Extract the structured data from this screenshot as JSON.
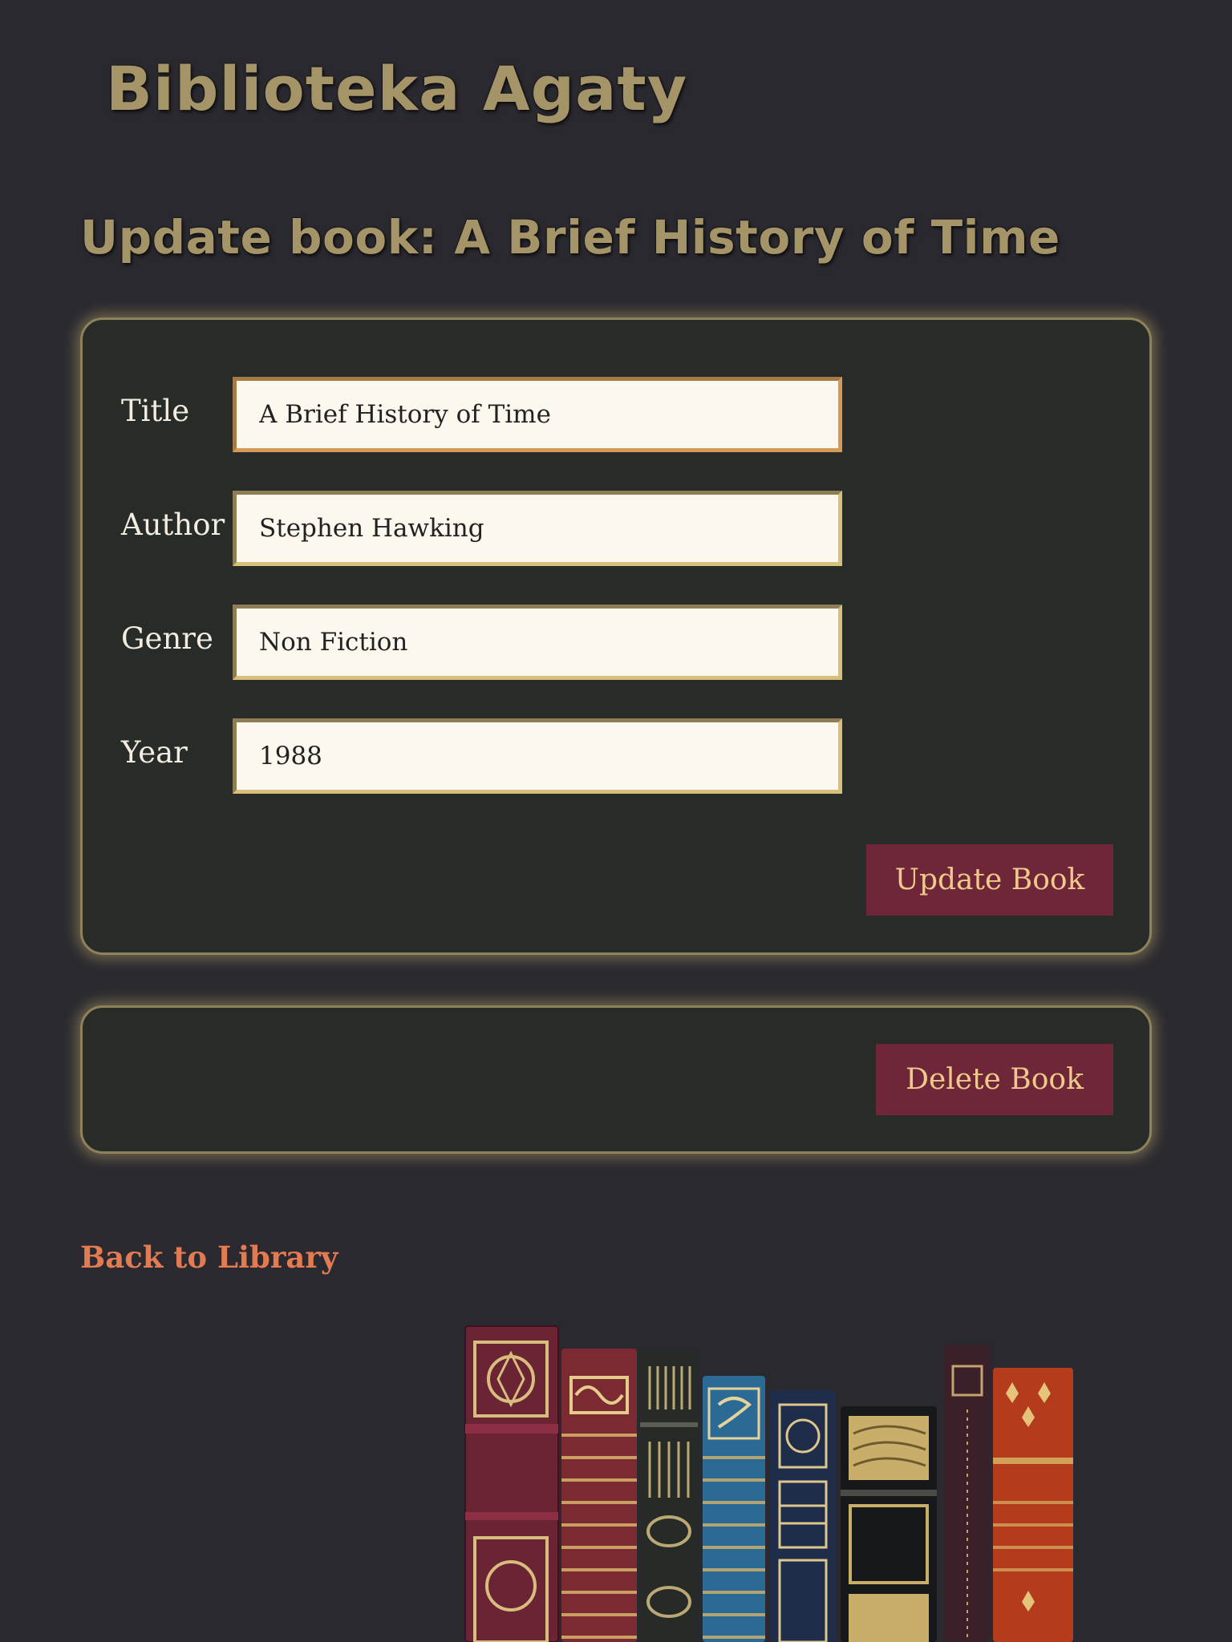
{
  "site": {
    "title": "Biblioteka Agaty"
  },
  "page": {
    "heading": "Update book: A Brief History of Time"
  },
  "form": {
    "fields": [
      {
        "label": "Title",
        "value": "A Brief History of Time"
      },
      {
        "label": "Author",
        "value": "Stephen Hawking"
      },
      {
        "label": "Genre",
        "value": "Non Fiction"
      },
      {
        "label": "Year",
        "value": "1988"
      }
    ],
    "submit_label": "Update Book"
  },
  "delete": {
    "button_label": "Delete Book"
  },
  "nav": {
    "back_label": "Back to Library"
  },
  "colors": {
    "background": "#2a292f",
    "panel": "#272c29",
    "heading": "#a59467",
    "button": "#6f2639",
    "button_text": "#eec98a",
    "link": "#e27b52"
  }
}
